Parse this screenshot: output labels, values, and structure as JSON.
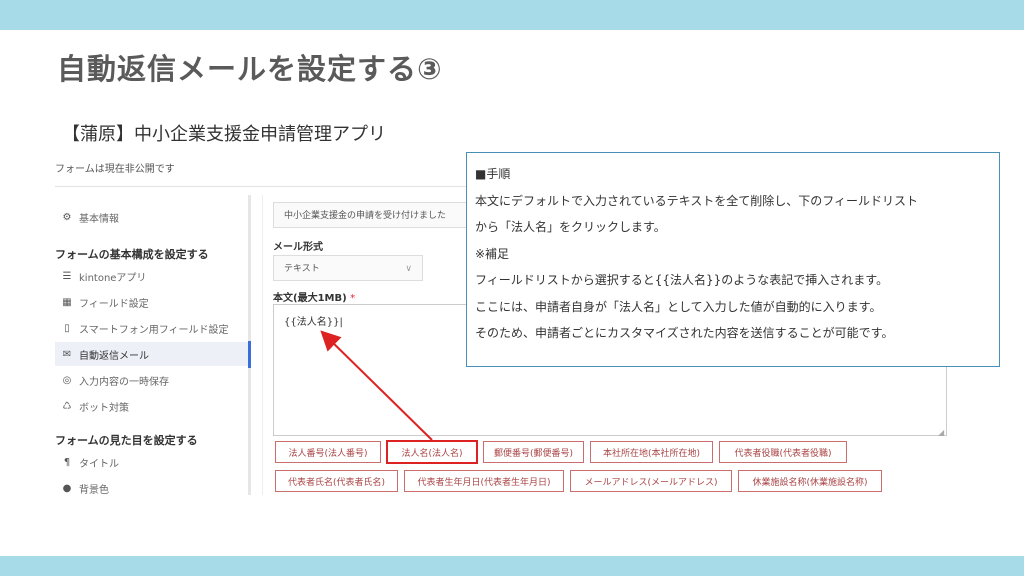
{
  "slide": {
    "title": "自動返信メールを設定する③"
  },
  "app": {
    "title": "【蒲原】中小企業支援金申請管理アプリ",
    "form_status": "フォームは現在非公開です"
  },
  "sidebar": {
    "basic_info": "基本情報",
    "section1_heading": "フォームの基本構成を設定する",
    "items1": [
      {
        "icon": "☰",
        "label": "kintoneアプリ"
      },
      {
        "icon": "▦",
        "label": "フィールド設定"
      },
      {
        "icon": "▯",
        "label": "スマートフォン用フィールド設定"
      },
      {
        "icon": "✉",
        "label": "自動返信メール"
      },
      {
        "icon": "◎",
        "label": "入力内容の一時保存"
      },
      {
        "icon": "♺",
        "label": "ボット対策"
      }
    ],
    "section2_heading": "フォームの見た目を設定する",
    "items2": [
      {
        "icon": "¶",
        "label": "タイトル"
      },
      {
        "icon": "●",
        "label": "背景色"
      }
    ]
  },
  "content": {
    "reply_text": "中小企業支援金の申請を受け付けました",
    "mail_format_label": "メール形式",
    "mail_format_value": "テキスト",
    "body_label": "本文(最大1MB)",
    "body_required": "*",
    "body_value": "{{法人名}}|",
    "field_buttons_row1": [
      "法人番号(法人番号)",
      "法人名(法人名)",
      "郵便番号(郵便番号)",
      "本社所在地(本社所在地)",
      "代表者役職(代表者役職)"
    ],
    "field_buttons_row2": [
      "代表者氏名(代表者氏名)",
      "代表者生年月日(代表者生年月日)",
      "メールアドレス(メールアドレス)",
      "休業施設名称(休業施設名称)"
    ]
  },
  "note": {
    "lines": [
      "■手順",
      "本文にデフォルトで入力されているテキストを全て削除し、下のフィールドリスト",
      "から「法人名」をクリックします。",
      "※補足",
      "フィールドリストから選択すると{{法人名}}のような表記で挿入されます。",
      "ここには、申請者自身が「法人名」として入力した値が自動的に入ります。",
      "そのため、申請者ごとにカスタマイズされた内容を送信することが可能です。"
    ]
  },
  "colors": {
    "band": "#a6dbe7",
    "highlight": "#dd2222",
    "note_border": "#4a8fb8"
  }
}
